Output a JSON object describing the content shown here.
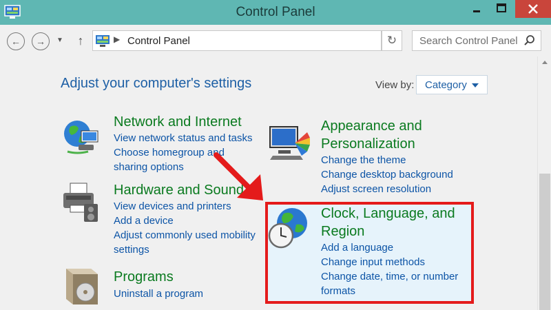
{
  "window": {
    "title": "Control Panel",
    "icons": {
      "app": "control-panel-icon",
      "minimize": "minimize-icon",
      "maximize": "maximize-icon",
      "close": "close-icon"
    },
    "colors": {
      "titlebar": "#5fb7b3",
      "close": "#c9453b",
      "heading": "#1d5fa5",
      "category_title": "#0a7a1f",
      "link": "#0c54a6",
      "highlight_border": "#e41b1b",
      "arrow": "#e41b1b"
    }
  },
  "nav": {
    "address": "Control Panel",
    "search_placeholder": "Search Control Panel",
    "icons": {
      "back": "back-arrow-icon",
      "forward": "forward-arrow-icon",
      "recent": "chevron-down-icon",
      "up": "up-arrow-icon",
      "refresh": "refresh-icon",
      "search": "search-icon"
    }
  },
  "main": {
    "heading": "Adjust your computer's settings",
    "view_by_label": "View by:",
    "view_by_value": "Category"
  },
  "categories": {
    "network": {
      "title": "Network and Internet",
      "icon": "network-globe-icon",
      "links": [
        "View network status and tasks",
        "Choose homegroup and sharing options"
      ]
    },
    "hardware": {
      "title": "Hardware and Sound",
      "icon": "printer-icon",
      "links": [
        "View devices and printers",
        "Add a device",
        "Adjust commonly used mobility settings"
      ]
    },
    "programs": {
      "title": "Programs",
      "icon": "programs-box-icon",
      "links": [
        "Uninstall a program"
      ]
    },
    "appearance": {
      "title": "Appearance and Personalization",
      "icon": "appearance-monitor-icon",
      "links": [
        "Change the theme",
        "Change desktop background",
        "Adjust screen resolution"
      ]
    },
    "clock": {
      "title": "Clock, Language, and Region",
      "icon": "clock-globe-icon",
      "links": [
        "Add a language",
        "Change input methods",
        "Change date, time, or number formats"
      ]
    }
  }
}
